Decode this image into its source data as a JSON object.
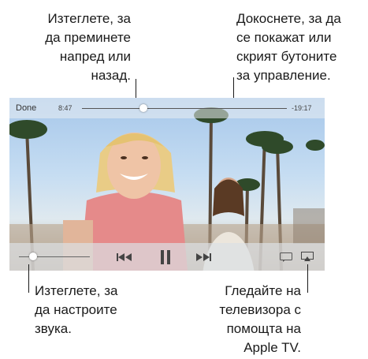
{
  "callouts": {
    "scrub": [
      "Изтеглете, за",
      "да преминете",
      "напред или",
      "назад."
    ],
    "tap": [
      "Докоснете, за да",
      "се покажат или",
      "скрият бутоните",
      "за управление."
    ],
    "volume": [
      "Изтеглете, за",
      "да настроите",
      "звука."
    ],
    "airplay": [
      "Гледайте на",
      "телевизора с",
      "помощта на",
      "Apple TV."
    ]
  },
  "player": {
    "done_label": "Done",
    "elapsed": "8:47",
    "remaining": "-19:17",
    "progress_fraction": 0.3,
    "volume_fraction": 0.2
  }
}
